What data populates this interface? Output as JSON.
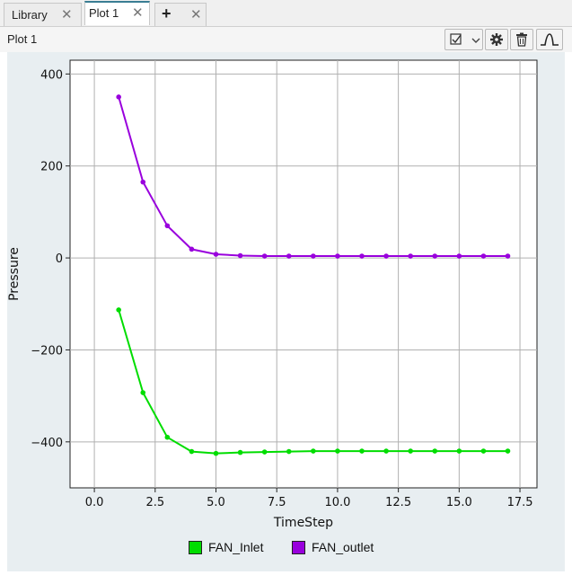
{
  "tabs": [
    {
      "label": "Library",
      "close": "✕"
    },
    {
      "label": "Plot 1",
      "close": "✕",
      "active": true
    },
    {
      "label": "+",
      "close": "✕"
    }
  ],
  "header": {
    "title": "Plot 1",
    "dropdown_icon": "checkbox-icon",
    "buttons": [
      "settings-icon",
      "trash-icon",
      "waveform-icon"
    ]
  },
  "chart_data": {
    "type": "line",
    "xlabel": "TimeStep",
    "ylabel": "Pressure",
    "xlim": [
      -1,
      18.2
    ],
    "ylim": [
      -500,
      430
    ],
    "xticks": [
      "0.0",
      "2.5",
      "5.0",
      "7.5",
      "10.0",
      "12.5",
      "15.0",
      "17.5"
    ],
    "xtick_values": [
      0,
      2.5,
      5,
      7.5,
      10,
      12.5,
      15,
      17.5
    ],
    "yticks": [
      "400",
      "200",
      "0",
      "−200",
      "−400"
    ],
    "ytick_values": [
      400,
      200,
      0,
      -200,
      -400
    ],
    "grid": true,
    "legend_position": "bottom-center",
    "x": [
      1,
      2,
      3,
      4,
      5,
      6,
      7,
      8,
      9,
      10,
      11,
      12,
      13,
      14,
      15,
      16,
      17
    ],
    "series": [
      {
        "name": "FAN_Inlet",
        "color": "#00dd00",
        "values": [
          -113,
          -293,
          -390,
          -421,
          -425,
          -423,
          -422,
          -421,
          -420,
          -420,
          -420,
          -420,
          -420,
          -420,
          -420,
          -420,
          -420
        ]
      },
      {
        "name": "FAN_outlet",
        "color": "#9900dd",
        "values": [
          350,
          165,
          70,
          19,
          8,
          5,
          4,
          4,
          4,
          4,
          4,
          4,
          4,
          4,
          4,
          4,
          4
        ]
      }
    ]
  }
}
